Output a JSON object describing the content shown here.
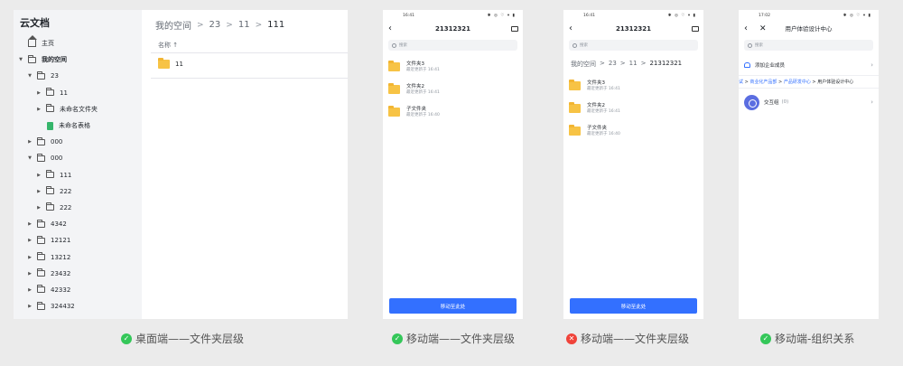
{
  "desktop": {
    "app_title": "云文档",
    "tree": [
      {
        "label": "主页",
        "indent": 0,
        "kind": "home",
        "arrow": ""
      },
      {
        "label": "我的空间",
        "indent": 0,
        "kind": "folder",
        "arrow": "▼",
        "bold": true
      },
      {
        "label": "23",
        "indent": 1,
        "kind": "folder",
        "arrow": "▼"
      },
      {
        "label": "11",
        "indent": 2,
        "kind": "folder",
        "arrow": "▶"
      },
      {
        "label": "未命名文件夹",
        "indent": 2,
        "kind": "folder",
        "arrow": "▶"
      },
      {
        "label": "未命名表格",
        "indent": 2,
        "kind": "sheet",
        "arrow": ""
      },
      {
        "label": "000",
        "indent": 1,
        "kind": "folder",
        "arrow": "▶"
      },
      {
        "label": "000",
        "indent": 1,
        "kind": "folder",
        "arrow": "▼"
      },
      {
        "label": "111",
        "indent": 2,
        "kind": "folder",
        "arrow": "▶"
      },
      {
        "label": "222",
        "indent": 2,
        "kind": "folder",
        "arrow": "▶"
      },
      {
        "label": "222",
        "indent": 2,
        "kind": "folder",
        "arrow": "▶"
      },
      {
        "label": "4342",
        "indent": 1,
        "kind": "folder",
        "arrow": "▶"
      },
      {
        "label": "12121",
        "indent": 1,
        "kind": "folder",
        "arrow": "▶"
      },
      {
        "label": "13212",
        "indent": 1,
        "kind": "folder",
        "arrow": "▶"
      },
      {
        "label": "23432",
        "indent": 1,
        "kind": "folder",
        "arrow": "▶"
      },
      {
        "label": "42332",
        "indent": 1,
        "kind": "folder",
        "arrow": "▶"
      },
      {
        "label": "324432",
        "indent": 1,
        "kind": "folder",
        "arrow": "▶"
      }
    ],
    "breadcrumb": {
      "root": "我的空间",
      "sep": ">",
      "p1": "23",
      "p2": "11",
      "last": "111"
    },
    "column_header": "名称 ↑",
    "rows": [
      {
        "name": "11"
      }
    ]
  },
  "phone1": {
    "time": "16:41",
    "status_icons": "✱ ◎ ♡ ▾ ▮",
    "title": "21312321",
    "search_placeholder": "搜索",
    "items": [
      {
        "name": "文件夹3",
        "sub": "最近更新于 16:41"
      },
      {
        "name": "文件夹2",
        "sub": "最近更新于 16:41"
      },
      {
        "name": "子文件夹",
        "sub": "最近更新于 16:40"
      }
    ],
    "move_button": "移动至此处"
  },
  "phone2": {
    "time": "16:41",
    "status_icons": "✱ ◎ ♡ ▾ ▮",
    "title": "21312321",
    "search_placeholder": "搜索",
    "breadcrumb": {
      "root": "我的空间",
      "sep": ">",
      "p1": "23",
      "p2": "11",
      "last": "21312321"
    },
    "items": [
      {
        "name": "文件夹3",
        "sub": "最近更新于 16:41"
      },
      {
        "name": "文件夹2",
        "sub": "最近更新于 16:41"
      },
      {
        "name": "子文件夹",
        "sub": "最近更新于 16:40"
      }
    ],
    "move_button": "移动至此处"
  },
  "phone3": {
    "time": "17:02",
    "status_icons": "✱ ◎ ♡ ▾ ▮",
    "title": "用户体验设计中心",
    "search_placeholder": "搜索",
    "add_member": "添加企业成员",
    "crumb_a": "试",
    "crumb_b": "商业化产品部",
    "crumb_c": "产品研发中心",
    "crumb_d": "用户体验设计中心",
    "crumb_sep": ">",
    "group_name": "交互组",
    "group_count": "(0)"
  },
  "captions": [
    {
      "status": "ok",
      "text": "桌面端——文件夹层级"
    },
    {
      "status": "ok",
      "text": "移动端——文件夹层级"
    },
    {
      "status": "no",
      "text": "移动端——文件夹层级"
    },
    {
      "status": "ok",
      "text": "移动端-组织关系"
    }
  ],
  "colors": {
    "primary": "#3370ff",
    "folder": "#f7c345",
    "ok": "#34c759",
    "error": "#f0433a"
  }
}
